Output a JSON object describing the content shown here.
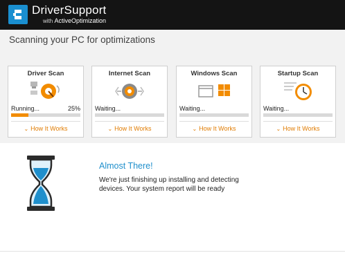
{
  "brand": {
    "title": "DriverSupport",
    "sub_prefix": "with ",
    "sub_accent": "ActiveOptimization",
    "logo_icon": "driversupport-logo-icon"
  },
  "scan": {
    "heading": "Scanning your PC for optimizations",
    "cards": [
      {
        "title": "Driver Scan",
        "status": "Running...",
        "percent": "25%",
        "progress": 0.25,
        "link": "How It Works",
        "icon": "driver-gear-icon"
      },
      {
        "title": "Internet Scan",
        "status": "Waiting...",
        "percent": "",
        "progress": 0,
        "link": "How It Works",
        "icon": "internet-gear-icon"
      },
      {
        "title": "Windows Scan",
        "status": "Waiting...",
        "percent": "",
        "progress": 0,
        "link": "How It Works",
        "icon": "windows-icon"
      },
      {
        "title": "Startup Scan",
        "status": "Waiting...",
        "percent": "",
        "progress": 0,
        "link": "How It Works",
        "icon": "clock-icon"
      }
    ]
  },
  "panel": {
    "title": "Almost There!",
    "description": "We're just finishing up installing and detecting devices. Your system report will be ready",
    "icon": "hourglass-icon"
  },
  "colors": {
    "accent": "#f28c00",
    "link": "#e07b00",
    "title_blue": "#1f8fcc",
    "header_bg": "#141414",
    "brand_blue": "#1a8fd0"
  }
}
